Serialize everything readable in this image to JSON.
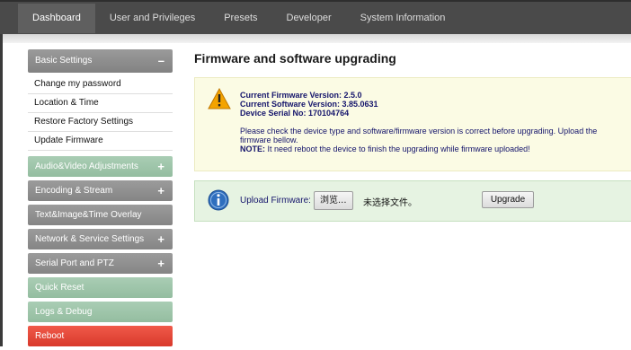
{
  "nav": {
    "tabs": [
      {
        "label": "Dashboard"
      },
      {
        "label": "User and Privileges"
      },
      {
        "label": "Presets"
      },
      {
        "label": "Developer"
      },
      {
        "label": "System Information"
      }
    ],
    "active_tab": "Dashboard"
  },
  "sidebar": {
    "basic": {
      "label": "Basic Settings",
      "sign": "–",
      "items": [
        {
          "label": "Change my password"
        },
        {
          "label": "Location & Time"
        },
        {
          "label": "Restore Factory Settings"
        },
        {
          "label": "Update Firmware"
        }
      ]
    },
    "sections": [
      {
        "label": "Audio&Video Adjustments",
        "sign": "+"
      },
      {
        "label": "Encoding & Stream",
        "sign": "+"
      },
      {
        "label": "Text&Image&Time Overlay",
        "sign": ""
      },
      {
        "label": "Network & Service Settings",
        "sign": "+"
      },
      {
        "label": "Serial Port and PTZ",
        "sign": "+"
      },
      {
        "label": "Quick Reset",
        "sign": ""
      },
      {
        "label": "Logs & Debug",
        "sign": ""
      },
      {
        "label": "Reboot",
        "sign": ""
      }
    ]
  },
  "main": {
    "title": "Firmware and software upgrading",
    "firmware_line": "Current Firmware Version: 2.5.0",
    "software_line": "Current Software Version: 3.85.0631",
    "serial_line": "Device Serial No: 170104764",
    "check_text": "Please check the device type and software/firmware version is correct before upgrading. Upload the firmware bellow.",
    "note_label": "NOTE:",
    "note_text": " It need reboot the device to finish the upgrading while firmware uploaded!",
    "upload_label": "Upload Firmware:",
    "browse_label": "浏览...",
    "no_file_text": "未选择文件。",
    "upgrade_label": "Upgrade"
  },
  "colors": {
    "topbar": "#4a4a4a",
    "sidebar_gray": "#8f8f8f",
    "sidebar_green": "#9fc6ab",
    "sidebar_red": "#e34a3a",
    "warn_bg": "#fbfbe4",
    "upload_bg": "#e6f3e2",
    "text_blue": "#14146b"
  }
}
